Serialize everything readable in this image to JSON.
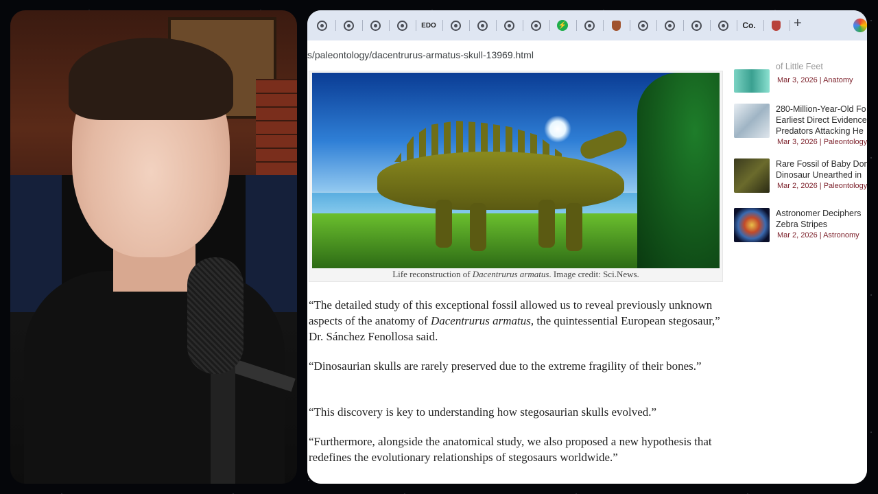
{
  "browser": {
    "url": "s/paleontology/dacentrurus-armatus-skull-13969.html",
    "tabs": [
      {
        "icon": "globe-icon"
      },
      {
        "icon": "globe-icon"
      },
      {
        "icon": "globe-icon"
      },
      {
        "icon": "globe-icon"
      },
      {
        "icon": "edo-text-icon",
        "label": "EDO"
      },
      {
        "icon": "globe-icon"
      },
      {
        "icon": "globe-icon"
      },
      {
        "icon": "globe-icon"
      },
      {
        "icon": "globe-icon"
      },
      {
        "icon": "green-bolt-icon"
      },
      {
        "icon": "globe-icon"
      },
      {
        "icon": "shield-icon"
      },
      {
        "icon": "globe-icon"
      },
      {
        "icon": "globe-icon"
      },
      {
        "icon": "globe-icon"
      },
      {
        "icon": "globe-icon"
      },
      {
        "icon": "co-text-icon",
        "label": "Co."
      },
      {
        "icon": "crest-icon"
      }
    ],
    "new_tab_label": "+"
  },
  "article": {
    "caption_prefix": "Life reconstruction of ",
    "caption_species": "Dacentrurus armatus",
    "caption_suffix": ". Image credit: Sci.News.",
    "p1_a": "“The detailed study of this exceptional fossil allowed us to reveal previously unknown aspects of the anatomy of ",
    "p1_species": "Dacentrurus armatus",
    "p1_b": ", the quintessential European stegosaur,” Dr. Sánchez Fenollosa said.",
    "p2": "“Dinosaurian skulls are rarely preserved due to the extreme fragility of their bones.”",
    "p3": "“This discovery is key to understanding how stegosaurian skulls evolved.”",
    "p4": "“Furthermore, alongside the anatomical study, we also proposed a new hypothesis that redefines the evolutionary relationships of stegosaurs worldwide.”"
  },
  "sidebar": {
    "items": [
      {
        "title": "of Little Feet",
        "date": "Mar 3, 2026",
        "sep": "|",
        "category": "Anatomy"
      },
      {
        "title": "280-Million-Year-Old Fo",
        "title2": "Earliest Direct Evidence",
        "title3": "Predators Attacking He",
        "date": "Mar 3, 2026",
        "sep": "|",
        "category": "Paleontology"
      },
      {
        "title": "Rare Fossil of Baby Don",
        "title2": "Dinosaur Unearthed in",
        "date": "Mar 2, 2026",
        "sep": "|",
        "category": "Paleontology"
      },
      {
        "title": "Astronomer Deciphers",
        "title2": "Zebra Stripes",
        "date": "Mar 2, 2026",
        "sep": "|",
        "category": "Astronomy"
      }
    ]
  },
  "colors": {
    "accent_link": "#7b1e28",
    "tabbar": "#dfe6f2"
  }
}
